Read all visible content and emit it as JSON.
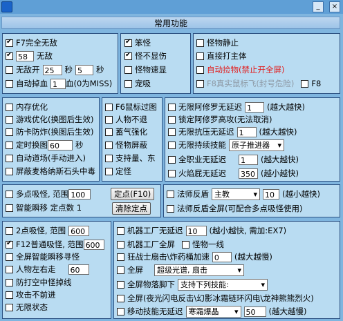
{
  "window": {
    "title": "",
    "minimize_label": "_",
    "close_label": "×"
  },
  "header": {
    "title": "常用功能"
  },
  "group1": {
    "f7": {
      "label": "F7完全无敌",
      "checked": true
    },
    "invincible": {
      "value": "58",
      "label": "无敌",
      "checked": true
    },
    "no_enemy": {
      "label": "无敌开",
      "value1": "25",
      "unit1": "秒",
      "value2": "5",
      "unit2": "秒",
      "checked": false
    },
    "auto_drop_hp": {
      "label": "自动掉血",
      "value": "1",
      "suffix": "血(0为MISS)",
      "checked": false
    }
  },
  "group2": [
    {
      "label": "笨怪",
      "checked": true
    },
    {
      "label": "怪不显伤",
      "checked": true
    },
    {
      "label": "怪物速显",
      "checked": false
    },
    {
      "label": "宠吸",
      "checked": false
    }
  ],
  "group3": [
    {
      "label": "怪物静止",
      "checked": false
    },
    {
      "label": "直接打主体",
      "checked": false
    },
    {
      "label": "自动捡物(禁止开全屏)",
      "checked": false
    },
    {
      "label": "F8真实鼠标飞(封号危险)",
      "checked": false,
      "f8": "F8"
    }
  ],
  "group4": [
    {
      "label": "内存优化",
      "checked": false
    },
    {
      "label": "游戏优化(换图后生效)",
      "checked": false
    },
    {
      "label": "防卡防炸(换图后生效)",
      "checked": false
    },
    {
      "label": "定时换图",
      "value": "60",
      "unit": "秒",
      "checked": false
    },
    {
      "label": "自动道场(手动进入)",
      "checked": false
    },
    {
      "label": "屏蔽麦格纳斯石头中毒",
      "checked": false
    }
  ],
  "group5": [
    {
      "label": "F6鼠标过图",
      "checked": false
    },
    {
      "label": "人物不退",
      "checked": false
    },
    {
      "label": "蓄气强化",
      "checked": false
    },
    {
      "label": "怪物屏蔽",
      "checked": false
    },
    {
      "label": "支持量、东",
      "checked": false
    },
    {
      "label": "定怪",
      "checked": false
    }
  ],
  "group6": {
    "ashura": {
      "label": "无限阿修罗无延迟",
      "value": "1",
      "hint": "(越大越快)",
      "checked": false
    },
    "lock_ashura": {
      "label": "锁定阿修罗高攻(无法取消)",
      "checked": false
    },
    "resist": {
      "label": "无限抗压无延迟",
      "value": "1",
      "hint": "(越大越快)",
      "checked": false
    },
    "skill": {
      "label": "无限持续技能",
      "select": "原子推进器",
      "checked": false
    },
    "full_shot": {
      "label": "全职业无延迟",
      "value": "1",
      "hint": "(越大越快)",
      "checked": false
    },
    "fire_arrow": {
      "label": "火焰屁无延迟",
      "value": "350",
      "hint": "(越小越快)",
      "checked": false
    }
  },
  "group7": {
    "multi": {
      "label": "多点吸怪, 范围",
      "value": "100",
      "button": "定点(F10)",
      "checked": false
    },
    "smart": {
      "label": "智能瞬移 定点数 1",
      "button": "清除定点",
      "checked": false
    }
  },
  "group8": {
    "reflect": {
      "label": "法师反盾",
      "select": "主教",
      "value": "10",
      "hint": "(越小越快)",
      "checked": false
    },
    "reflect_full": {
      "label": "法师反盾全屏(可配合多点吸怪使用)",
      "checked": false
    }
  },
  "group9": [
    {
      "label": "2点吸怪, 范围",
      "value": "600",
      "checked": false
    },
    {
      "label": "F12普通吸怪, 范围",
      "value": "600",
      "checked": true
    },
    {
      "label": "全屏智能瞬移寻怪",
      "checked": false
    },
    {
      "label": "人物左右走",
      "value": "60",
      "checked": false
    },
    {
      "label": "防打空中怪掉线",
      "checked": false
    },
    {
      "label": "攻击不前进",
      "checked": false
    },
    {
      "label": "无限状态",
      "checked": false
    }
  ],
  "group10": {
    "factory": {
      "label": "机器工厂无延迟",
      "value": "10",
      "hint": "(越小越快, 需加:EX7)",
      "checked": false
    },
    "factory_full": {
      "label": "机器工厂全屏",
      "checked": false,
      "extra": "怪物一线",
      "extra_checked": false
    },
    "bomb": {
      "label": "狂战士扇击\\炸药桶加速",
      "value": "0",
      "hint": "(越大越慢)",
      "checked": false
    },
    "full": {
      "label": "全屏",
      "select": "超级光谱, 扇击",
      "checked": false
    },
    "drop": {
      "label": "全屏物落脚下",
      "select": "支持下列技能:",
      "checked": false
    },
    "full_list": {
      "label": "全屏(夜光闪电反击\\幻影冰霜链环闪电\\龙神熊熊烈火)",
      "checked": false
    },
    "move": {
      "label": "移动技能无延迟",
      "select": "寒霜爆晶",
      "value": "50",
      "hint": "(越大越慢)",
      "checked": false
    }
  }
}
